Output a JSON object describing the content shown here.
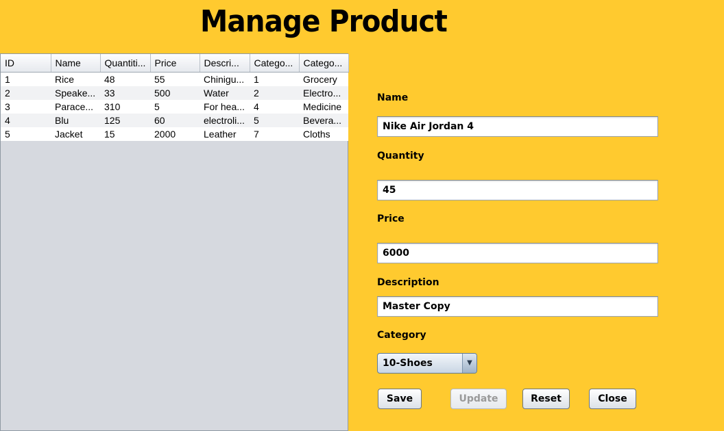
{
  "page": {
    "title": "Manage Product"
  },
  "table": {
    "columns": [
      "ID",
      "Name",
      "Quantiti...",
      "Price",
      "Descri...",
      "Catego...",
      "Catego..."
    ],
    "rows": [
      [
        "1",
        "Rice",
        "48",
        "55",
        "Chinigu...",
        "1",
        "Grocery"
      ],
      [
        "2",
        "Speake...",
        "33",
        "500",
        "Water",
        "2",
        "Electro..."
      ],
      [
        "3",
        "Parace...",
        "310",
        "5",
        "For hea...",
        "4",
        "Medicine"
      ],
      [
        "4",
        "Blu",
        "125",
        "60",
        "electroli...",
        "5",
        "Bevera..."
      ],
      [
        "5",
        "Jacket",
        "15",
        "2000",
        "Leather",
        "7",
        "Cloths"
      ]
    ]
  },
  "form": {
    "name_label": "Name",
    "name_value": "Nike Air Jordan 4",
    "quantity_label": "Quantity",
    "quantity_value": "45",
    "price_label": "Price",
    "price_value": "6000",
    "description_label": "Description",
    "description_value": "Master Copy",
    "category_label": "Category",
    "category_value": "10-Shoes",
    "category_icon": "chevron-down-icon"
  },
  "buttons": {
    "save": "Save",
    "update": "Update",
    "update_enabled": false,
    "reset": "Reset",
    "close": "Close"
  },
  "colors": {
    "background": "#FFCA2F",
    "table_empty_area": "#D6D9DF"
  }
}
